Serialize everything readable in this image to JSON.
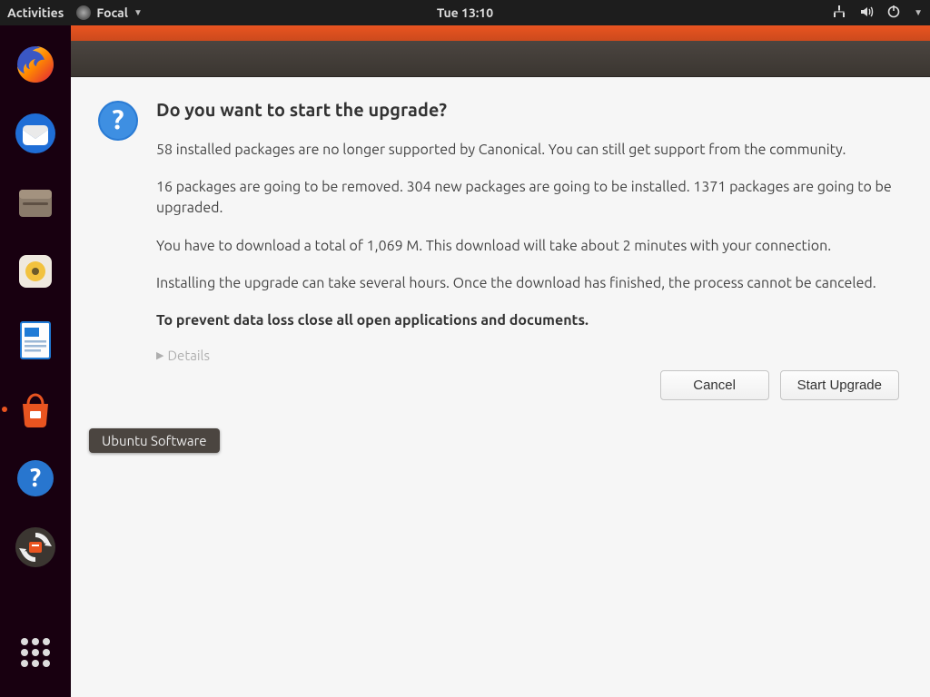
{
  "topbar": {
    "activities": "Activities",
    "appmenu_label": "Focal",
    "clock": "Tue 13:10"
  },
  "dock": {
    "items": [
      {
        "name": "firefox-icon",
        "label": "Firefox"
      },
      {
        "name": "thunderbird-icon",
        "label": "Thunderbird"
      },
      {
        "name": "files-icon",
        "label": "Files"
      },
      {
        "name": "rhythmbox-icon",
        "label": "Rhythmbox"
      },
      {
        "name": "writer-icon",
        "label": "LibreOffice Writer"
      },
      {
        "name": "software-icon",
        "label": "Ubuntu Software"
      },
      {
        "name": "help-icon",
        "label": "Help"
      },
      {
        "name": "updater-icon",
        "label": "Software Updater"
      }
    ],
    "tooltip": "Ubuntu Software"
  },
  "dialog": {
    "title": "Do you want to start the upgrade?",
    "para1": "58 installed packages are no longer supported by Canonical. You can still get support from the community.",
    "para2": "16 packages are going to be removed. 304 new packages are going to be installed. 1371 packages are going to be upgraded.",
    "para3": "You have to download a total of 1,069 M. This download will take about 2 minutes with your connection.",
    "para4": "Installing the upgrade can take several hours. Once the download has finished, the process cannot be canceled.",
    "para5": "To prevent data loss close all open applications and documents.",
    "details_label": "Details",
    "cancel": "Cancel",
    "start": "Start Upgrade"
  },
  "colors": {
    "accent": "#e95420"
  }
}
